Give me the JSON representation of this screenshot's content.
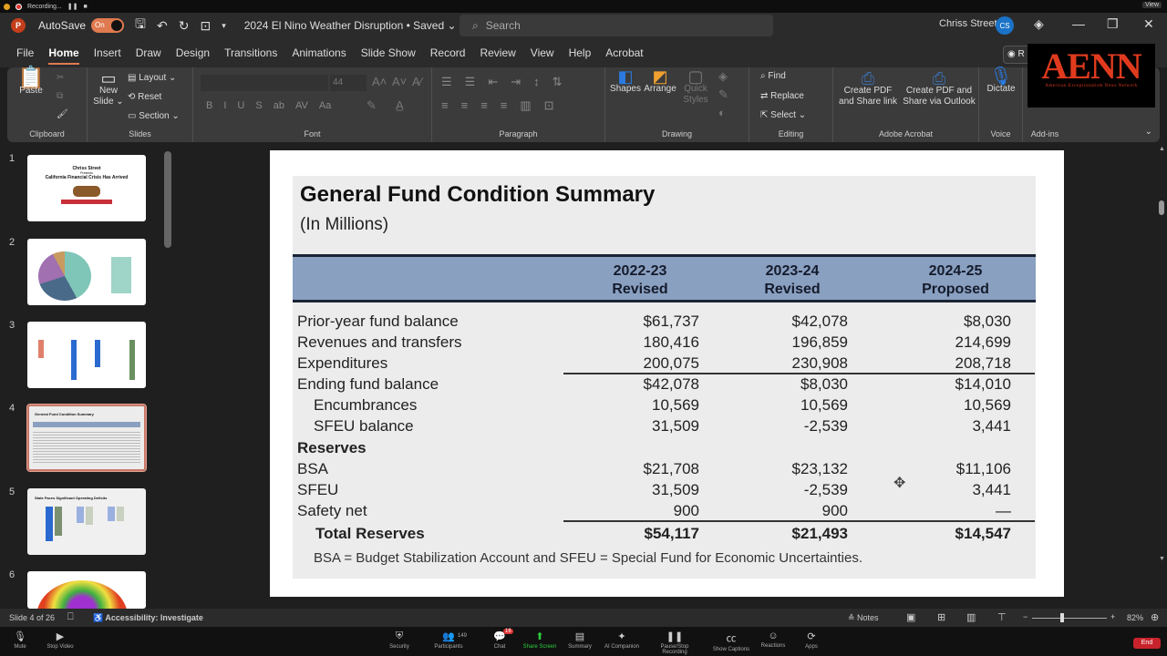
{
  "recording": {
    "label": "Recording...",
    "view_label": "View"
  },
  "titlebar": {
    "autosave_label": "AutoSave",
    "autosave_state": "On",
    "document_title": "2024 El Nino Weather Disruption • Saved ⌄",
    "search_placeholder": "Search",
    "user_name": "Chriss Street",
    "user_initials": "CS"
  },
  "menu": [
    "File",
    "Home",
    "Insert",
    "Draw",
    "Design",
    "Transitions",
    "Animations",
    "Slide Show",
    "Record",
    "Review",
    "View",
    "Help",
    "Acrobat"
  ],
  "menu_active": "Home",
  "record_button": "R",
  "ribbon": {
    "clipboard": {
      "label": "Clipboard",
      "paste": "Paste"
    },
    "slides": {
      "label": "Slides",
      "new_slide": "New Slide ⌄",
      "layout": "Layout ⌄",
      "reset": "Reset",
      "section": "Section ⌄"
    },
    "font": {
      "label": "Font",
      "font_size": "44",
      "buttons": [
        "B",
        "I",
        "U",
        "S",
        "ab",
        "AV",
        "Aa"
      ]
    },
    "paragraph": {
      "label": "Paragraph"
    },
    "drawing": {
      "label": "Drawing",
      "shapes": "Shapes",
      "arrange": "Arrange",
      "quick_styles": "Quick Styles"
    },
    "editing": {
      "label": "Editing",
      "find": "Find",
      "replace": "Replace",
      "select": "Select ⌄"
    },
    "acrobat": {
      "label": "Adobe Acrobat",
      "create_share_link": "Create PDF and Share link",
      "create_share_outlook": "Create PDF and Share via Outlook"
    },
    "voice": {
      "label": "Voice",
      "dictate": "Dictate"
    },
    "addins": {
      "label": "Add-ins"
    }
  },
  "overlay_logo": {
    "title": "AENN",
    "subtitle": "American Exceptionalism News Network"
  },
  "thumbnails": [
    {
      "num": "1",
      "title": "Chriss Street",
      "sub": "Presents",
      "heading": "California Financial Crisis Has Arrived"
    },
    {
      "num": "2"
    },
    {
      "num": "3"
    },
    {
      "num": "4",
      "selected": true,
      "title": "General Fund Condition Summary"
    },
    {
      "num": "5",
      "title": "State Faces Significant Operating Deficits"
    },
    {
      "num": "6"
    }
  ],
  "slide": {
    "title": "General Fund Condition Summary",
    "subtitle": "(In Millions)",
    "columns": [
      {
        "year": "2022-23",
        "status": "Revised"
      },
      {
        "year": "2023-24",
        "status": "Revised"
      },
      {
        "year": "2024-25",
        "status": "Proposed"
      }
    ],
    "rows": [
      {
        "label": "Prior-year fund balance",
        "values": [
          "$61,737",
          "$42,078",
          "$8,030"
        ]
      },
      {
        "label": "Revenues and transfers",
        "values": [
          "180,416",
          "196,859",
          "214,699"
        ]
      },
      {
        "label": "Expenditures",
        "values": [
          "200,075",
          "230,908",
          "208,718"
        ]
      },
      {
        "label": "Ending fund balance",
        "values": [
          "$42,078",
          "$8,030",
          "$14,010"
        ]
      },
      {
        "label": "Encumbrances",
        "values": [
          "10,569",
          "10,569",
          "10,569"
        ]
      },
      {
        "label": "SFEU balance",
        "values": [
          "31,509",
          "-2,539",
          "3,441"
        ]
      },
      {
        "label": "Reserves",
        "values": [
          "",
          "",
          ""
        ]
      },
      {
        "label": "BSA",
        "values": [
          "$21,708",
          "$23,132",
          "$11,106"
        ]
      },
      {
        "label": "SFEU",
        "values": [
          "31,509",
          "-2,539",
          "3,441"
        ]
      },
      {
        "label": "Safety net",
        "values": [
          "900",
          "900",
          "—"
        ]
      },
      {
        "label": "Total Reserves",
        "values": [
          "$54,117",
          "$21,493",
          "$14,547"
        ]
      }
    ],
    "footnote": "BSA = Budget Stabilization Account and SFEU = Special Fund for Economic Uncertainties."
  },
  "status": {
    "slide_counter": "Slide 4 of 26",
    "accessibility": "Accessibility: Investigate",
    "notes": "Notes",
    "zoom_level": "82%"
  },
  "meeting_toolbar": {
    "items": [
      "Mute",
      "Stop Video",
      "Security",
      "Participants",
      "Chat",
      "Share Screen",
      "Summary",
      "AI Companion",
      "Pause/Stop Recording",
      "Show Captions",
      "Reactions",
      "Apps"
    ],
    "participants_count": "149",
    "chat_badge": "16",
    "end_label": "End"
  }
}
